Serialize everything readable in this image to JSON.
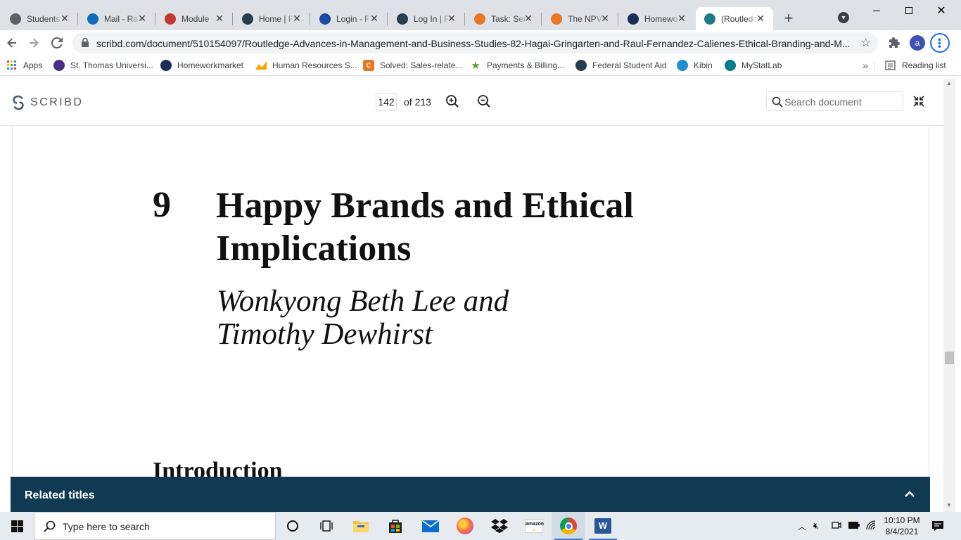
{
  "browser": {
    "tabs": [
      {
        "title": "Students",
        "favicon": "globe-icon",
        "color": "#5f6368"
      },
      {
        "title": "Mail - Ro",
        "favicon": "outlook-icon",
        "color": "#0f6cbd"
      },
      {
        "title": "Module",
        "favicon": "course-icon",
        "color": "#c0392b"
      },
      {
        "title": "Home | F",
        "favicon": "fsa-icon",
        "color": "#263d4f"
      },
      {
        "title": "Login - F",
        "favicon": "globe-icon",
        "color": "#1a4aa3"
      },
      {
        "title": "Log In | F",
        "favicon": "fsa-icon",
        "color": "#263d4f"
      },
      {
        "title": "Task: Ser",
        "favicon": "chegg-icon",
        "color": "#e87722"
      },
      {
        "title": "The NPV",
        "favicon": "chegg-icon",
        "color": "#e87722"
      },
      {
        "title": "Homewo",
        "favicon": "homework-icon",
        "color": "#1b2d5a"
      },
      {
        "title": "(Routledc",
        "favicon": "scribd-icon",
        "color": "#1e7b85",
        "active": true
      }
    ],
    "new_tab": "+",
    "url": "scribd.com/document/510154097/Routledge-Advances-in-Management-and-Business-Studies-82-Hagai-Gringarten-and-Raul-Fernandez-Calienes-Ethical-Branding-and-M...",
    "profile_initial": "a",
    "bookmarks": [
      {
        "label": "Apps",
        "icon": "apps-grid-icon",
        "color": "#ea4335"
      },
      {
        "label": "St. Thomas Universi...",
        "icon": "university-icon",
        "color": "#4b2e83"
      },
      {
        "label": "Homeworkmarket",
        "icon": "homework-icon",
        "color": "#1b2d5a"
      },
      {
        "label": "Human Resources S...",
        "icon": "chart-icon",
        "color": "#f4a300"
      },
      {
        "label": "Solved: Sales-relate...",
        "icon": "chegg-icon",
        "color": "#e87722"
      },
      {
        "label": "Payments & Billing...",
        "icon": "star-icon",
        "color": "#5aa02c"
      },
      {
        "label": "Federal Student Aid",
        "icon": "fsa-icon",
        "color": "#263d4f"
      },
      {
        "label": "Kibin",
        "icon": "kibin-icon",
        "color": "#1a8fd1"
      },
      {
        "label": "MyStatLab",
        "icon": "mystatlab-icon",
        "color": "#007b8a"
      }
    ],
    "reading_list": "Reading list"
  },
  "scribd": {
    "logo": "SCRIBD",
    "page_current": "142",
    "page_total": "of 213",
    "search_placeholder": "Search document"
  },
  "document": {
    "chapter_number": "9",
    "chapter_title_line1": "Happy Brands and Ethical",
    "chapter_title_line2": "Implications",
    "authors_line1": "Wonkyong Beth Lee and",
    "authors_line2": "Timothy Dewhirst",
    "section_heading": "Introduction"
  },
  "related": {
    "label": "Related titles"
  },
  "taskbar": {
    "search_placeholder": "Type here to search",
    "time": "10:10 PM",
    "date": "8/4/2021"
  }
}
